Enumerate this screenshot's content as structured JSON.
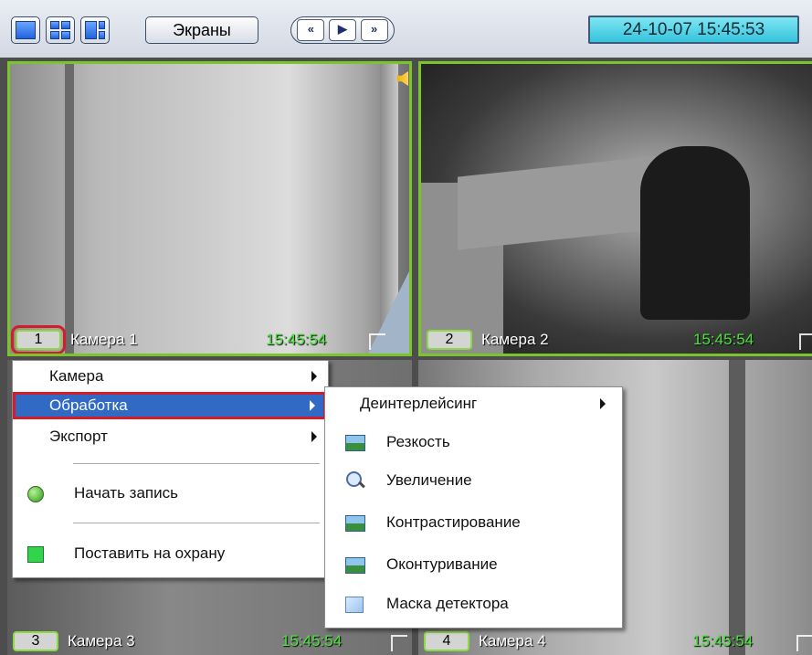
{
  "toolbar": {
    "screens_label": "Экраны",
    "datetime": "24-10-07   15:45:53",
    "nav": {
      "prev": "«",
      "play": "▶",
      "next": "»"
    }
  },
  "cameras": [
    {
      "number": "1",
      "name": "Камера 1",
      "time": "15:45:54"
    },
    {
      "number": "2",
      "name": "Камера 2",
      "time": "15:45:54"
    },
    {
      "number": "3",
      "name": "Камера 3",
      "time": "15:45:54"
    },
    {
      "number": "4",
      "name": "Камера 4",
      "time": "15:45:54"
    }
  ],
  "context_menu": {
    "items": [
      {
        "label": "Камера",
        "submenu": true
      },
      {
        "label": "Обработка",
        "submenu": true,
        "active": true
      },
      {
        "label": "Экспорт",
        "submenu": true
      },
      {
        "label": "Начать запись",
        "icon": "green-dot-icon"
      },
      {
        "label": "Поставить на охрану",
        "icon": "green-square-icon"
      }
    ]
  },
  "submenu": {
    "items": [
      {
        "label": "Деинтерлейсинг",
        "submenu": true
      },
      {
        "label": "Резкость",
        "icon": "picture-icon"
      },
      {
        "label": "Увеличение",
        "icon": "magnifier-icon"
      },
      {
        "label": "Контрастирование",
        "icon": "picture-icon"
      },
      {
        "label": "Оконтуривание",
        "icon": "picture-icon"
      },
      {
        "label": "Маска детектора",
        "icon": "mask-icon"
      }
    ]
  },
  "colors": {
    "active_frame": "#7ac628",
    "time_text": "#49e33b",
    "highlight": "#d41d2a",
    "menu_selection": "#316ac5"
  }
}
